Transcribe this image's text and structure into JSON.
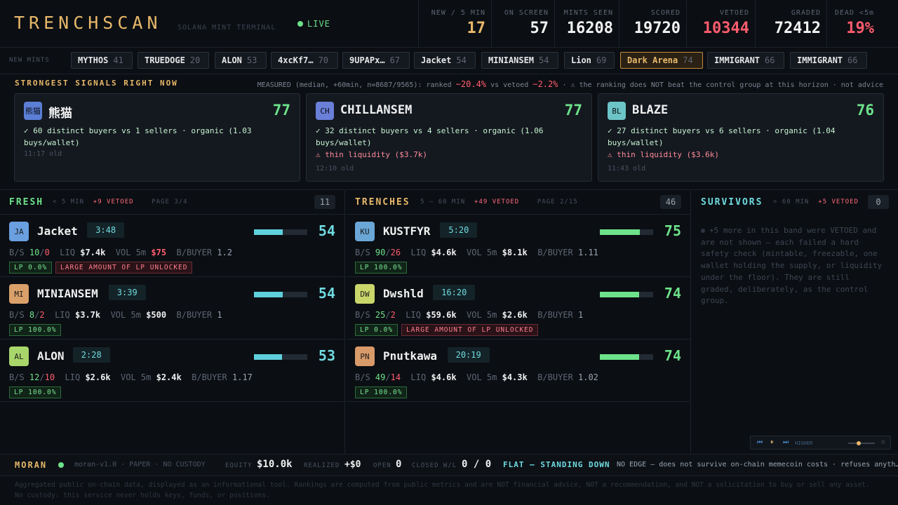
{
  "header": {
    "brand": "TRENCHSCAN",
    "tagline": "SOLANA MINT TERMINAL",
    "live": "LIVE",
    "stats": [
      {
        "label": "NEW / 5 MIN",
        "value": "17",
        "color": "#e8b86a"
      },
      {
        "label": "ON SCREEN",
        "value": "57",
        "color": "#f2f2f2"
      },
      {
        "label": "MINTS SEEN",
        "value": "16208",
        "color": "#f2f2f2"
      },
      {
        "label": "SCORED",
        "value": "19720",
        "color": "#f2f2f2"
      },
      {
        "label": "VETOED",
        "value": "10344",
        "color": "#ff5d6e"
      },
      {
        "label": "GRADED",
        "value": "72412",
        "color": "#f2f2f2"
      },
      {
        "label": "DEAD <5m",
        "value": "19%",
        "color": "#ff5d6e"
      }
    ]
  },
  "mints": {
    "label": "NEW MINTS",
    "items": [
      {
        "name": "MYTHOS",
        "score": "41"
      },
      {
        "name": "TRUEDOGE",
        "score": "20"
      },
      {
        "name": "ALON",
        "score": "53"
      },
      {
        "name": "4xcKf7…",
        "score": "70"
      },
      {
        "name": "9UPAPx…",
        "score": "67"
      },
      {
        "name": "Jacket",
        "score": "54"
      },
      {
        "name": "MINIANSEM",
        "score": "54"
      },
      {
        "name": "Lion",
        "score": "69"
      },
      {
        "name": "Dark Arena",
        "score": "74"
      },
      {
        "name": "IMMIGRANT",
        "score": "66"
      },
      {
        "name": "IMMIGRANT",
        "score": "66"
      }
    ]
  },
  "signals": {
    "title": "STRONGEST SIGNALS RIGHT NOW",
    "measured_prefix": "MEASURED (median, +60min, n=8687/9565): ranked",
    "ranked": "−20.4%",
    "vs": "vs vetoed",
    "vetoed": "−2.2%",
    "note": "· ⚠ the ranking does NOT beat the control group at this horizon · not advice",
    "cards": [
      {
        "avatar": "熊猫",
        "name": "熊猫",
        "score": "77",
        "line1": "✓ 60 distinct buyers vs 1 sellers · organic (1.03 buys/wallet)",
        "line2": "",
        "age": "11:17 old",
        "color": "#5b7fd6"
      },
      {
        "avatar": "CH",
        "name": "CHILLANSEM",
        "score": "77",
        "line1": "✓ 32 distinct buyers vs 4 sellers · organic (1.06 buys/wallet)",
        "line2": "⚠ thin liquidity ($3.7k)",
        "age": "12:10 old",
        "color": "#6a7fd8"
      },
      {
        "avatar": "BL",
        "name": "BLAZE",
        "score": "76",
        "line1": "✓ 27 distinct buyers vs 6 sellers · organic (1.04 buys/wallet)",
        "line2": "⚠ thin liquidity ($3.6k)",
        "age": "11:43 old",
        "color": "#6cc4c6"
      }
    ]
  },
  "columns": {
    "fresh": {
      "title": "FRESH",
      "range": "< 5 MIN",
      "vetoed": "+9 VETOED",
      "page": "PAGE 3/4",
      "count": "11",
      "color": "#6de28a"
    },
    "trenches": {
      "title": "TRENCHES",
      "range": "5 – 60 MIN",
      "vetoed": "+49 VETOED",
      "page": "PAGE 2/15",
      "count": "46",
      "color": "#e8b86a"
    },
    "survivors": {
      "title": "SURVIVORS",
      "range": "> 60 MIN",
      "vetoed": "+5 VETOED",
      "count": "0",
      "color": "#6fdbe0",
      "note": "+5 more in this band were VETOED and are not shown — each failed a hard safety check (mintable, freezable, one wallet holding the supply, or liquidity under the floor). They are still graded, deliberately, as the control group."
    }
  },
  "fresh_rows": [
    {
      "av": "JA",
      "name": "Jacket",
      "time": "3:48",
      "score": "54",
      "fill": 0.54,
      "buys": "10",
      "sells": "0",
      "liq": "$7.4k",
      "vol": "$75",
      "volbad": true,
      "bpb": "1.2",
      "lp": "LP 0.0%",
      "warn": "LARGE AMOUNT OF LP UNLOCKED",
      "avc": "#6a9fe0"
    },
    {
      "av": "MI",
      "name": "MINIANSEM",
      "time": "3:39",
      "score": "54",
      "fill": 0.54,
      "buys": "8",
      "sells": "2",
      "liq": "$3.7k",
      "vol": "$500",
      "volbad": false,
      "bpb": "1",
      "lp": "LP 100.0%",
      "warn": "",
      "avc": "#d9a06a"
    },
    {
      "av": "AL",
      "name": "ALON",
      "time": "2:28",
      "score": "53",
      "fill": 0.53,
      "buys": "12",
      "sells": "10",
      "liq": "$2.6k",
      "vol": "$2.4k",
      "volbad": false,
      "bpb": "1.17",
      "lp": "LP 100.0%",
      "warn": "",
      "avc": "#a8d66a"
    }
  ],
  "trench_rows": [
    {
      "av": "KU",
      "name": "KUSTFYR",
      "time": "5:20",
      "score": "75",
      "fill": 0.75,
      "buys": "90",
      "sells": "26",
      "liq": "$4.6k",
      "vol": "$8.1k",
      "volbad": false,
      "bpb": "1.11",
      "lp": "LP 100.0%",
      "warn": "",
      "avc": "#6aa6d6"
    },
    {
      "av": "DW",
      "name": "Dwshld",
      "time": "16:20",
      "score": "74",
      "fill": 0.74,
      "buys": "25",
      "sells": "2",
      "liq": "$59.6k",
      "vol": "$2.6k",
      "volbad": false,
      "bpb": "1",
      "lp": "LP 0.0%",
      "warn": "LARGE AMOUNT OF LP UNLOCKED",
      "avc": "#c9d66a"
    },
    {
      "av": "PN",
      "name": "Pnutkawa",
      "time": "20:19",
      "score": "74",
      "fill": 0.74,
      "buys": "49",
      "sells": "14",
      "liq": "$4.6k",
      "vol": "$4.3k",
      "volbad": false,
      "bpb": "1.02",
      "lp": "LP 100.0%",
      "warn": "",
      "avc": "#d99a6a"
    }
  ],
  "row_labels": {
    "bs": "B/S",
    "liq": "LIQ",
    "vol": "VOL 5m",
    "bpb": "B/BUYER"
  },
  "player": {
    "label": "HIGHER"
  },
  "footer": {
    "name": "MORAN",
    "version": "moran-v1.0 · PAPER · NO CUSTODY",
    "equity_label": "EQUITY",
    "equity": "$10.0k",
    "realized_label": "REALIZED",
    "realized": "+$0",
    "open_label": "OPEN",
    "open": "0",
    "closed_label": "CLOSED W/L",
    "closed": "0 / 0",
    "state": "FLAT — STANDING DOWN",
    "edge": "NO EDGE — does not survive on-chain memecoin costs · refuses anyth…"
  },
  "disclaimer": "Aggregated public on-chain data, displayed as an informational tool. Rankings are computed from public metrics and are NOT financial advice, NOT a recommendation, and NOT a solicitation to buy or sell any asset. No custody: this service never holds keys, funds, or positions."
}
